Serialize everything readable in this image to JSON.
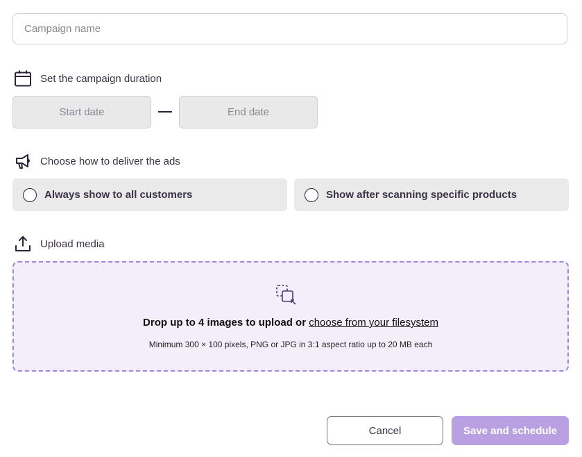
{
  "campaign": {
    "name_value": "",
    "name_placeholder": "Campaign name"
  },
  "duration": {
    "label": "Set the campaign duration",
    "icon": "calendar-icon",
    "start_label": "Start date",
    "end_label": "End date"
  },
  "delivery": {
    "label": "Choose how to deliver the ads",
    "icon": "megaphone-icon",
    "options": [
      {
        "label": "Always show to all customers",
        "selected": false
      },
      {
        "label": "Show after scanning specific products",
        "selected": false
      }
    ]
  },
  "upload": {
    "label": "Upload media",
    "icon": "upload-icon",
    "drop_icon": "drag-drop-icon",
    "drop_text": "Drop up to 4 images to upload or ",
    "drop_link": "choose from your filesystem",
    "requirements": "Minimum 300 × 100 pixels, PNG or JPG in 3:1 aspect ratio up to 20 MB each"
  },
  "actions": {
    "cancel_label": "Cancel",
    "save_label": "Save and schedule"
  },
  "colors": {
    "accent": "#b9a0e2",
    "dropzone_border": "#a384dc",
    "dropzone_bg": "#f3effa",
    "text": "#2b2238"
  }
}
